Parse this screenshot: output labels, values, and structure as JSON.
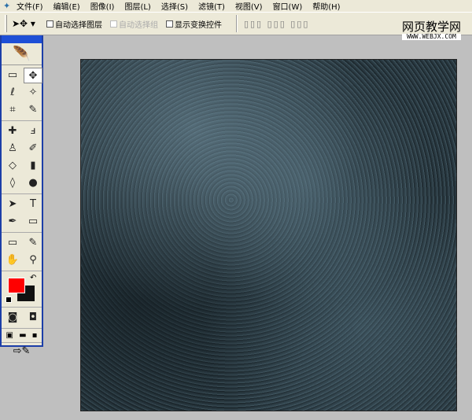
{
  "menu": {
    "items": [
      "文件(F)",
      "编辑(E)",
      "图像(I)",
      "图层(L)",
      "选择(S)",
      "滤镜(T)",
      "视图(V)",
      "窗口(W)",
      "帮助(H)"
    ]
  },
  "options": {
    "tool_icon": "move-tool-icon",
    "auto_select_layer": "自动选择图层",
    "auto_select_group": "自动选择组",
    "show_transform": "显示变换控件",
    "align_icons": "▯▯▯ ▯▯▯ ▯▯▯"
  },
  "watermark": {
    "name": "网页教学网",
    "url": "WWW.WEBJX.COM"
  },
  "toolbox": {
    "tools": [
      "▭",
      "✥",
      "ℓ",
      "✧",
      "⌗",
      "✎",
      "✚",
      "ⅎ",
      "♙",
      "✐",
      "◇",
      "▮",
      "◊",
      "●",
      "➤",
      "T",
      "✒",
      "▭",
      "▭",
      "✎",
      "✋",
      "⚲"
    ],
    "foreground_color": "#ff0000",
    "background_color": "#111111"
  },
  "canvas": {
    "texture_colors": [
      "#2b3a41",
      "#6e8a98"
    ]
  }
}
